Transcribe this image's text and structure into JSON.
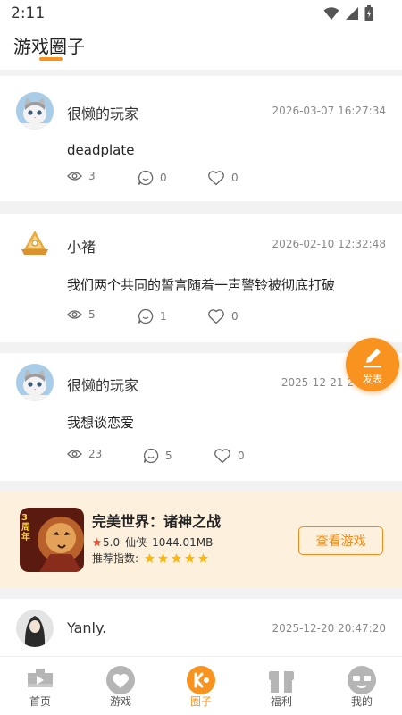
{
  "status_bar": {
    "time": "2:11"
  },
  "header": {
    "title": "游戏圈子"
  },
  "posts": [
    {
      "author": "很懒的玩家",
      "time": "2026-03-07 16:27:34",
      "content": "deadplate",
      "views": "3",
      "comments": "0",
      "likes": "0"
    },
    {
      "author": "小褚",
      "time": "2026-02-10 12:32:48",
      "content": "我们两个共同的誓言随着一声警铃被彻底打破",
      "views": "5",
      "comments": "1",
      "likes": "0"
    },
    {
      "author": "很懒的玩家",
      "time": "2025-12-21 2",
      "content": "我想谈恋爱",
      "views": "23",
      "comments": "5",
      "likes": "0"
    },
    {
      "author": "Yanly.",
      "time": "2025-12-20 20:47:20"
    }
  ],
  "ad": {
    "title": "完美世界：诸神之战",
    "rating": "5.0",
    "genre": "仙侠",
    "size": "1044.01MB",
    "recommend_label": "推荐指数:",
    "stars": 5,
    "button": "查看游戏",
    "cover_text": "3周年"
  },
  "fab": {
    "label": "发表"
  },
  "tabs": [
    {
      "label": "首页",
      "icon": "home-icon"
    },
    {
      "label": "游戏",
      "icon": "game-icon"
    },
    {
      "label": "圈子",
      "icon": "circle-icon",
      "active": true
    },
    {
      "label": "福利",
      "icon": "gift-icon"
    },
    {
      "label": "我的",
      "icon": "profile-icon"
    }
  ],
  "colors": {
    "accent": "#f7931e",
    "ad_bg": "#fdf1dd",
    "star": "#fbb80f"
  }
}
